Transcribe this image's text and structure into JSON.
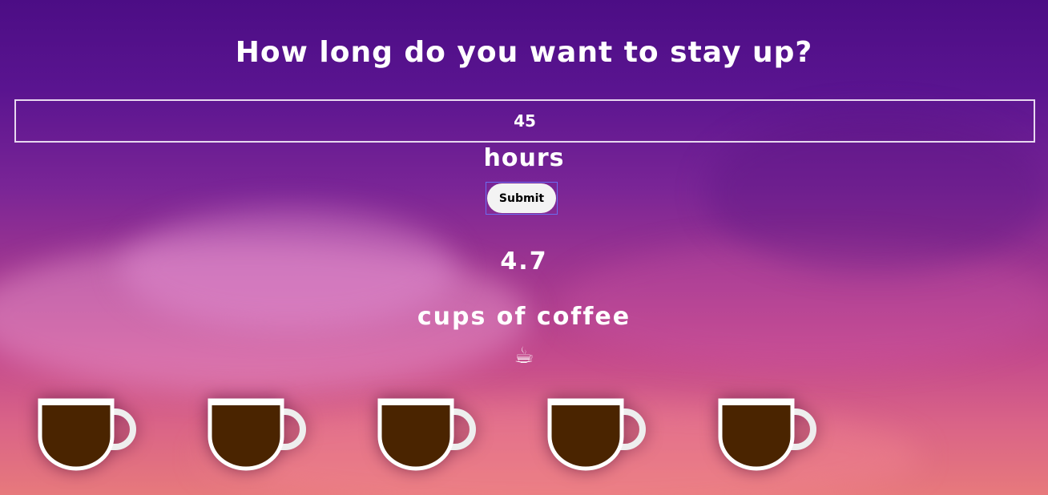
{
  "question": "How long do you want to stay up?",
  "hours_input": {
    "value": "45"
  },
  "hours_label": "hours",
  "submit_label": "Submit",
  "result": {
    "value": "4.7",
    "unit": "cups of coffee"
  },
  "emoji": "☕",
  "cups": {
    "count": 5,
    "fill_color": "#4a2400",
    "cup_color": "#ffffff"
  }
}
